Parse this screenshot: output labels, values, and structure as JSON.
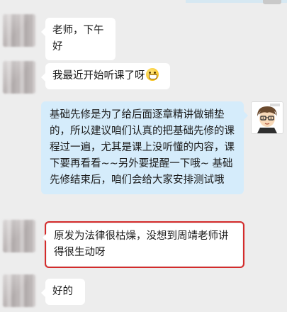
{
  "messages": [
    {
      "side": "left",
      "text": "老师，下午好"
    },
    {
      "side": "left",
      "text": "我最近开始听课了呀",
      "emoji": "grin-emoji"
    },
    {
      "side": "right",
      "text": "基础先修是为了给后面逐章精讲做铺垫的，所以建议咱们认真的把基础先修的课程过一遍，尤其是课上没听懂的内容，课下要再看看~~另外要提醒一下哦~ 基础先修结束后，咱们会给大家安排测试哦"
    },
    {
      "side": "left",
      "text": "原发为法律很枯燥，没想到周靖老师讲得很生动呀",
      "highlighted": true
    },
    {
      "side": "left",
      "text": "好的"
    }
  ],
  "colors": {
    "background": "#ededed",
    "incoming_bubble": "#ffffff",
    "outgoing_bubble": "#d5ecfb",
    "highlight_box": "#d42b2b"
  },
  "icons": [
    "blurred-avatar",
    "teacher-cartoon-avatar",
    "grin-emoji"
  ]
}
